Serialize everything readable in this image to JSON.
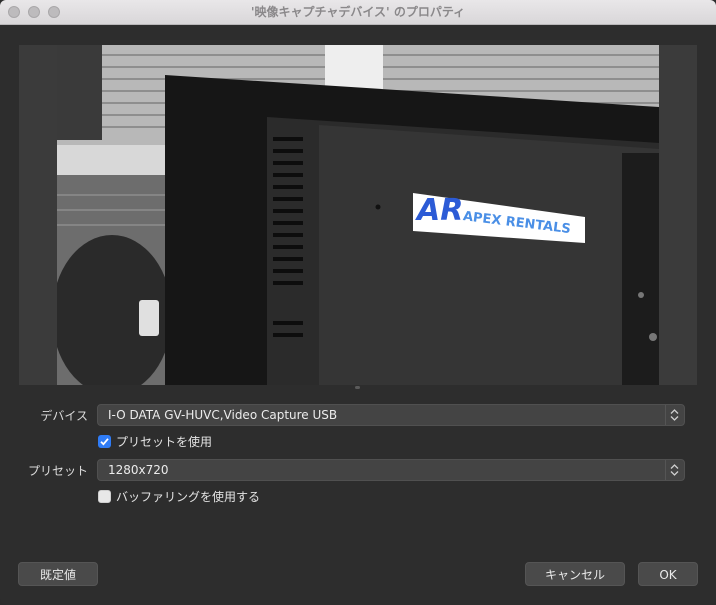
{
  "window": {
    "title": "'映像キャプチャデバイス' のプロパティ"
  },
  "preview": {
    "sticker_text": "APEX RENTALS",
    "sticker_logo": "AR-logo"
  },
  "form": {
    "device_label": "デバイス",
    "device_value": "I-O DATA GV-HUVC,Video Capture USB",
    "use_preset_label": "プリセットを使用",
    "use_preset_checked": true,
    "preset_label": "プリセット",
    "preset_value": "1280x720",
    "buffering_label": "バッファリングを使用する",
    "buffering_checked": false
  },
  "buttons": {
    "defaults": "既定値",
    "cancel": "キャンセル",
    "ok": "OK"
  },
  "colors": {
    "accent": "#2f7cf6",
    "sticker_blue": "#2c5bd6"
  }
}
